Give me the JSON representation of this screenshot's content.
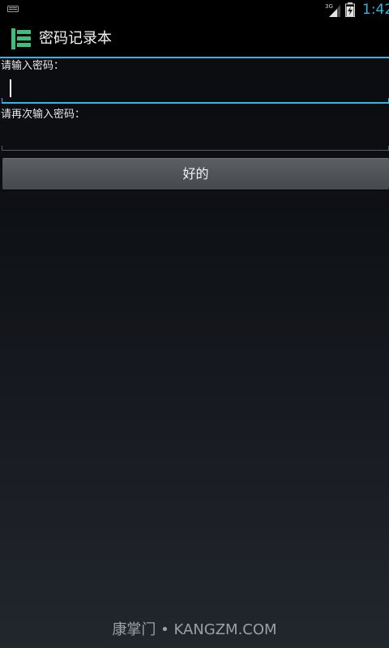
{
  "status_bar": {
    "network_type": "3G",
    "time": "1:42"
  },
  "action_bar": {
    "title": "密码记录本",
    "app_icon": "list-app-icon"
  },
  "form": {
    "password_label": "请输入密码：",
    "password_value": "",
    "confirm_label": "请再次输入密码：",
    "confirm_value": "",
    "ok_button_label": "好的"
  },
  "watermark": "康掌门 • KANGZM.COM",
  "colors": {
    "accent": "#33b5e5",
    "icon_green": "#3dbf7a"
  }
}
